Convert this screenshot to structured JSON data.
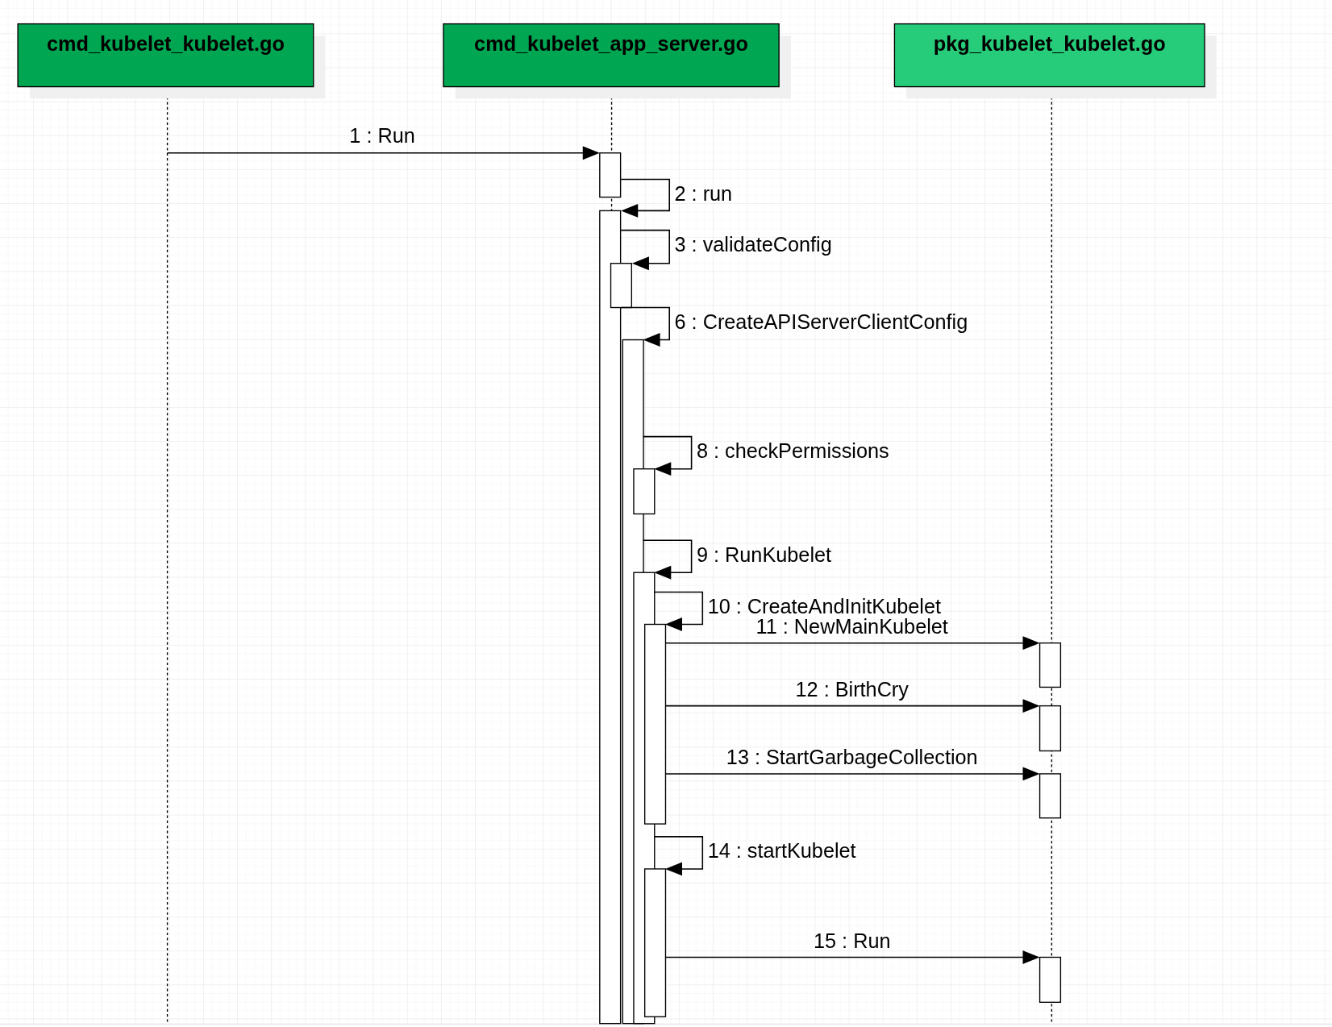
{
  "participants": [
    {
      "name": "cmd_kubelet_kubelet.go",
      "color": "#00a651"
    },
    {
      "name": "cmd_kubelet_app_server.go",
      "color": "#00a651"
    },
    {
      "name": "pkg_kubelet_kubelet.go",
      "color": "#26cc79"
    }
  ],
  "messages": [
    {
      "label": "1 : Run",
      "kind": "call"
    },
    {
      "label": "2 : run",
      "kind": "self"
    },
    {
      "label": "3 : validateConfig",
      "kind": "self"
    },
    {
      "label": "6 : CreateAPIServerClientConfig",
      "kind": "self"
    },
    {
      "label": "8 : checkPermissions",
      "kind": "self"
    },
    {
      "label": "9 : RunKubelet",
      "kind": "self"
    },
    {
      "label": "10 : CreateAndInitKubelet",
      "kind": "self"
    },
    {
      "label": "11 : NewMainKubelet",
      "kind": "call"
    },
    {
      "label": "12 : BirthCry",
      "kind": "call"
    },
    {
      "label": "13 : StartGarbageCollection",
      "kind": "call"
    },
    {
      "label": "14 : startKubelet",
      "kind": "self"
    },
    {
      "label": "15 : Run",
      "kind": "call"
    }
  ]
}
